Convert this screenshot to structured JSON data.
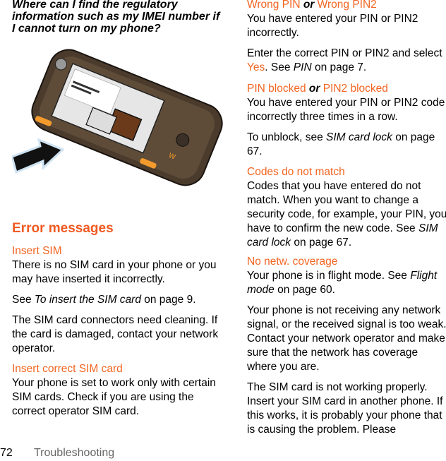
{
  "left": {
    "question": "Where can I find the regulatory information such as my IMEI number if I cannot turn on my phone?",
    "illustration": "phone-battery-compartment-illustration",
    "section_title": "Error messages",
    "insert_sim": {
      "title": "Insert SIM",
      "p1": "There is no SIM card in your phone or you may have inserted it incorrectly.",
      "p2_pre": "See ",
      "p2_ref": "To insert the SIM card",
      "p2_post": " on page 9.",
      "p3": "The SIM card connectors need cleaning. If the card is damaged, contact your network operator."
    },
    "insert_correct": {
      "title": "Insert correct SIM card",
      "p1": "Your phone is set to work only with certain SIM cards. Check if you are using the correct operator SIM card."
    }
  },
  "right": {
    "wrong_pin": {
      "t1": "Wrong PIN",
      "or": " or ",
      "t2": "Wrong PIN2",
      "p1": "You have entered your PIN or PIN2 incorrectly.",
      "p2_pre": "Enter the correct PIN or PIN2 and select ",
      "p2_yes": "Yes",
      "p2_mid": ". See ",
      "p2_ref": "PIN",
      "p2_post": " on page 7."
    },
    "pin_blocked": {
      "t1": "PIN blocked",
      "or": " or ",
      "t2": "PIN2 blocked",
      "p1": "You have entered your PIN or PIN2 code incorrectly three times in a row.",
      "p2_pre": "To unblock, see ",
      "p2_ref": "SIM card lock",
      "p2_post": " on page 67."
    },
    "codes": {
      "title": "Codes do not match",
      "p1_pre": "Codes that you have entered do not match. When you want to change a security code, for example, your PIN, you have to confirm the new code. See ",
      "p1_ref": "SIM card lock",
      "p1_post": " on page 67."
    },
    "no_netw": {
      "title": "No netw. coverage",
      "p1_pre": "Your phone is in flight mode. See ",
      "p1_ref": "Flight mode",
      "p1_post": " on page 60.",
      "p2": "Your phone is not receiving any network signal, or the received signal is too weak. Contact your network operator and make sure that the network has coverage where you are.",
      "p3": "The SIM card is not working properly. Insert your SIM card in another phone. If this works, it is probably your phone that is causing the problem. Please"
    }
  },
  "footer": {
    "page_number": "72",
    "section": "Troubleshooting"
  },
  "colors": {
    "accent": "#f26522",
    "footer_text": "#666666"
  }
}
